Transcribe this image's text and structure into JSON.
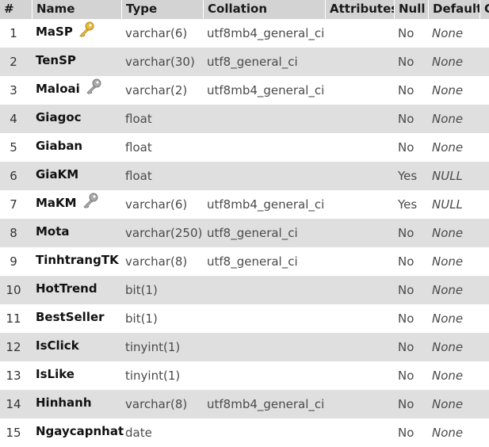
{
  "columns": [
    "#",
    "Name",
    "Type",
    "Collation",
    "Attributes",
    "Null",
    "Default",
    "C"
  ],
  "rows": [
    {
      "num": "1",
      "name": "MaSP",
      "type": "varchar(6)",
      "collation": "utf8mb4_general_ci",
      "null": "No",
      "default": "None",
      "key": "primary-key-icon"
    },
    {
      "num": "2",
      "name": "TenSP",
      "type": "varchar(30)",
      "collation": "utf8_general_ci",
      "null": "No",
      "default": "None",
      "key": ""
    },
    {
      "num": "3",
      "name": "Maloai",
      "type": "varchar(2)",
      "collation": "utf8mb4_general_ci",
      "null": "No",
      "default": "None",
      "key": "index-key-icon"
    },
    {
      "num": "4",
      "name": "Giagoc",
      "type": "float",
      "collation": "",
      "null": "No",
      "default": "None",
      "key": ""
    },
    {
      "num": "5",
      "name": "Giaban",
      "type": "float",
      "collation": "",
      "null": "No",
      "default": "None",
      "key": ""
    },
    {
      "num": "6",
      "name": "GiaKM",
      "type": "float",
      "collation": "",
      "null": "Yes",
      "default": "NULL",
      "key": ""
    },
    {
      "num": "7",
      "name": "MaKM",
      "type": "varchar(6)",
      "collation": "utf8mb4_general_ci",
      "null": "Yes",
      "default": "NULL",
      "key": "index-key-icon"
    },
    {
      "num": "8",
      "name": "Mota",
      "type": "varchar(250)",
      "collation": "utf8_general_ci",
      "null": "No",
      "default": "None",
      "key": ""
    },
    {
      "num": "9",
      "name": "TinhtrangTK",
      "type": "varchar(8)",
      "collation": "utf8_general_ci",
      "null": "No",
      "default": "None",
      "key": ""
    },
    {
      "num": "10",
      "name": "HotTrend",
      "type": "bit(1)",
      "collation": "",
      "null": "No",
      "default": "None",
      "key": ""
    },
    {
      "num": "11",
      "name": "BestSeller",
      "type": "bit(1)",
      "collation": "",
      "null": "No",
      "default": "None",
      "key": ""
    },
    {
      "num": "12",
      "name": "IsClick",
      "type": "tinyint(1)",
      "collation": "",
      "null": "No",
      "default": "None",
      "key": ""
    },
    {
      "num": "13",
      "name": "IsLike",
      "type": "tinyint(1)",
      "collation": "",
      "null": "No",
      "default": "None",
      "key": ""
    },
    {
      "num": "14",
      "name": "Hinhanh",
      "type": "varchar(8)",
      "collation": "utf8mb4_general_ci",
      "null": "No",
      "default": "None",
      "key": ""
    },
    {
      "num": "15",
      "name": "Ngaycapnhat",
      "type": "date",
      "collation": "",
      "null": "No",
      "default": "None",
      "key": ""
    }
  ],
  "colors": {
    "header_bg": "#d3d3d3",
    "row_even_bg": "#dfdfdf",
    "row_odd_bg": "#ffffff",
    "primary_key": "#e8b93c",
    "index_key": "#a9a9a9"
  }
}
